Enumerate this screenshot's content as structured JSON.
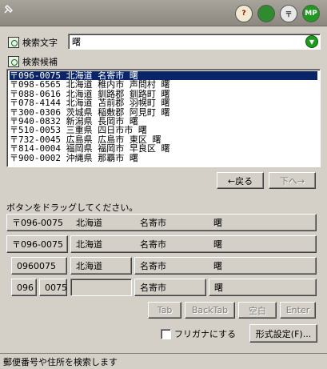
{
  "toolbar": {
    "icons": [
      "help-book-icon",
      "green-book-icon",
      "address-card-icon",
      "mp-icon"
    ],
    "mp_label": "MP"
  },
  "search": {
    "label": "検索文字",
    "value": "曙"
  },
  "candidates": {
    "label": "検索候補",
    "rows": [
      "〒096-0075 北海道 名寄市 曙",
      "〒098-6565 北海道 稚内市 声問村 曙",
      "〒088-0616 北海道 釧路郡 釧路町 曙",
      "〒078-4144 北海道 苫前郡 羽幌町 曙",
      "〒300-0306 茨城県 稲敷郡 阿見町 曙",
      "〒940-0832 新潟県 長岡市 曙",
      "〒510-0053 三重県 四日市市 曙",
      "〒732-0045 広島県 広島市 東区 曙",
      "〒814-0004 福岡県 福岡市 早良区 曙",
      "〒900-0002 沖縄県 那覇市 曙"
    ],
    "selected_index": 0
  },
  "nav": {
    "back_label": "←戻る",
    "next_label": "下へ→"
  },
  "drag": {
    "hint": "ボタンをドラッグしてください。",
    "row1": [
      "〒096-0075",
      "北海道",
      "名寄市",
      "曙"
    ],
    "row2": [
      "〒096-0075",
      "北海道",
      "名寄市",
      "曙"
    ],
    "row3": [
      "0960075",
      "北海道",
      "名寄市",
      "曙"
    ],
    "row4": [
      "096",
      "0075",
      "",
      "名寄市",
      "曙"
    ]
  },
  "keys": {
    "tab": "Tab",
    "backtab": "BackTab",
    "space": "空白",
    "enter": "Enter"
  },
  "options": {
    "furigana_label": "フリガナにする",
    "format_label": "形式設定(F)..."
  },
  "status": {
    "text": "郵便番号や住所を検索します"
  }
}
